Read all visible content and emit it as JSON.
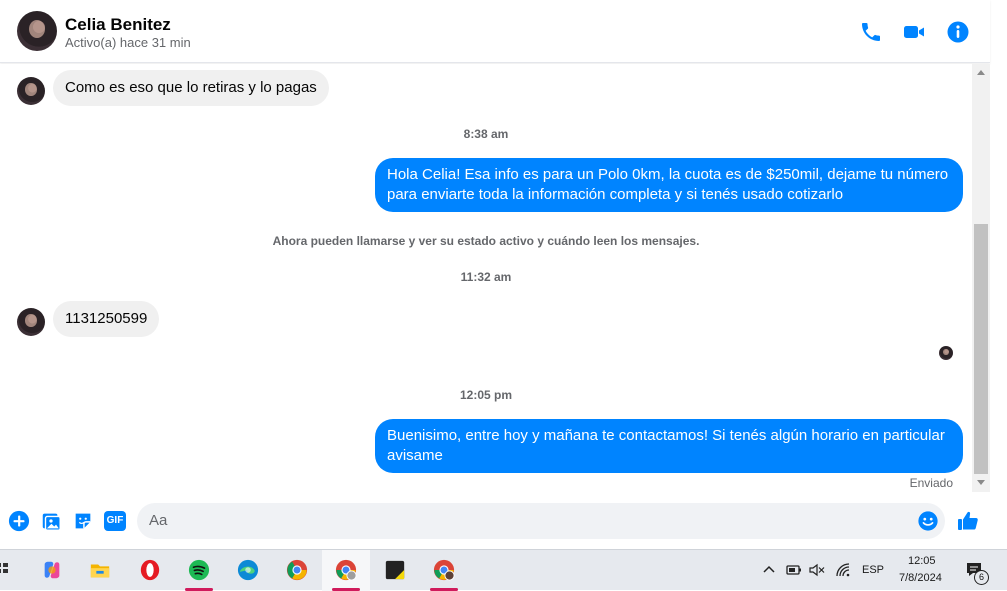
{
  "header": {
    "contact_name": "Celia Benitez",
    "status": "Activo(a) hace 31 min",
    "icons": [
      "phone-icon",
      "video-icon",
      "info-icon"
    ]
  },
  "messages": [
    {
      "type": "incoming",
      "text": "Como es eso que lo retiras y lo pagas"
    },
    {
      "type": "timestamp",
      "text": "8:38 am"
    },
    {
      "type": "outgoing",
      "text": "Hola Celia! Esa info es para un Polo 0km, la cuota es de $250mil, dejame tu número para enviarte toda la información completa y si tenés usado cotizarlo"
    },
    {
      "type": "notice",
      "text": "Ahora pueden llamarse y ver su estado activo y cuándo leen los mensajes."
    },
    {
      "type": "timestamp",
      "text": "11:32 am"
    },
    {
      "type": "incoming",
      "text": "1131250599"
    },
    {
      "type": "timestamp",
      "text": "12:05 pm"
    },
    {
      "type": "outgoing",
      "text": "Buenisimo, entre hoy y mañana te contactamos! Si tenés algún horario en particular avisame"
    },
    {
      "type": "status",
      "text": "Enviado"
    }
  ],
  "composer": {
    "placeholder": "Aa",
    "gif_label": "GIF",
    "icons": [
      "plus-icon",
      "photo-icon",
      "sticker-icon",
      "gif-icon",
      "emoji-icon",
      "like-icon"
    ]
  },
  "taskbar": {
    "language": "ESP",
    "time": "12:05",
    "date": "7/8/2024",
    "notifications": "6",
    "apps": [
      "copilot",
      "file-explorer",
      "opera",
      "spotify",
      "edge",
      "chrome",
      "chrome-profile",
      "sticky-notes",
      "chrome-profile-2"
    ]
  },
  "colors": {
    "accent": "#0084ff",
    "incoming_bubble": "#f0f0f0",
    "taskbar_indicator": "#d01b5c"
  }
}
